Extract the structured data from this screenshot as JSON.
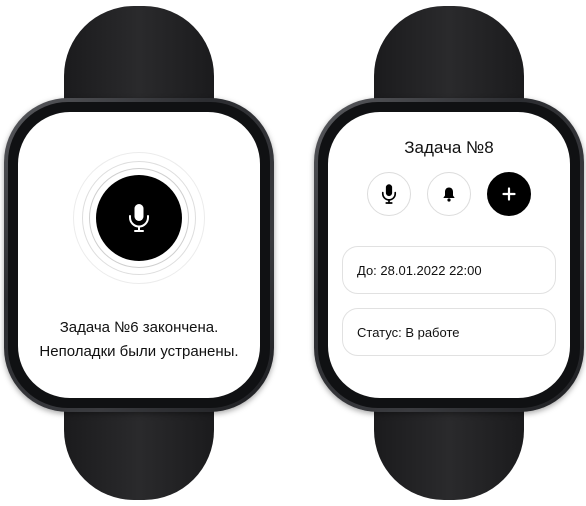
{
  "left_watch": {
    "message_line1": "Задача №6 закончена.",
    "message_line2": "Неполадки были устранены.",
    "mic_icon": "microphone-icon"
  },
  "right_watch": {
    "title": "Задача №8",
    "actions": [
      {
        "icon": "microphone-icon"
      },
      {
        "icon": "bell-icon"
      },
      {
        "icon": "plus-icon"
      }
    ],
    "due_text": "До: 28.01.2022 22:00",
    "status_text": "Статус: В работе"
  },
  "colors": {
    "screen_background": "#ffffff",
    "primary": "#000000",
    "card_border": "#e1e1e1",
    "band": "#1b1b1d"
  }
}
